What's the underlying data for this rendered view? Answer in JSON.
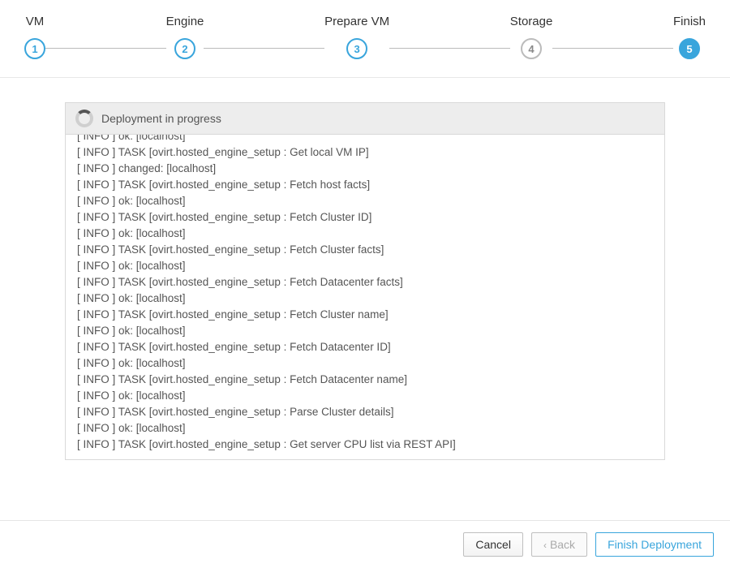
{
  "wizard": {
    "steps": [
      {
        "label": "VM",
        "num": "1",
        "state": "done"
      },
      {
        "label": "Engine",
        "num": "2",
        "state": "done"
      },
      {
        "label": "Prepare VM",
        "num": "3",
        "state": "done"
      },
      {
        "label": "Storage",
        "num": "4",
        "state": "muted"
      },
      {
        "label": "Finish",
        "num": "5",
        "state": "active"
      }
    ]
  },
  "status": {
    "message": "Deployment in progress"
  },
  "log_lines": [
    "[ INFO ] ok: [localhost]",
    "[ INFO ] TASK [ovirt.hosted_engine_setup : Get local VM IP]",
    "[ INFO ] changed: [localhost]",
    "[ INFO ] TASK [ovirt.hosted_engine_setup : Fetch host facts]",
    "[ INFO ] ok: [localhost]",
    "[ INFO ] TASK [ovirt.hosted_engine_setup : Fetch Cluster ID]",
    "[ INFO ] ok: [localhost]",
    "[ INFO ] TASK [ovirt.hosted_engine_setup : Fetch Cluster facts]",
    "[ INFO ] ok: [localhost]",
    "[ INFO ] TASK [ovirt.hosted_engine_setup : Fetch Datacenter facts]",
    "[ INFO ] ok: [localhost]",
    "[ INFO ] TASK [ovirt.hosted_engine_setup : Fetch Cluster name]",
    "[ INFO ] ok: [localhost]",
    "[ INFO ] TASK [ovirt.hosted_engine_setup : Fetch Datacenter ID]",
    "[ INFO ] ok: [localhost]",
    "[ INFO ] TASK [ovirt.hosted_engine_setup : Fetch Datacenter name]",
    "[ INFO ] ok: [localhost]",
    "[ INFO ] TASK [ovirt.hosted_engine_setup : Parse Cluster details]",
    "[ INFO ] ok: [localhost]",
    "[ INFO ] TASK [ovirt.hosted_engine_setup : Get server CPU list via REST API]"
  ],
  "footer": {
    "cancel": "Cancel",
    "back": "Back",
    "finish": "Finish Deployment"
  }
}
